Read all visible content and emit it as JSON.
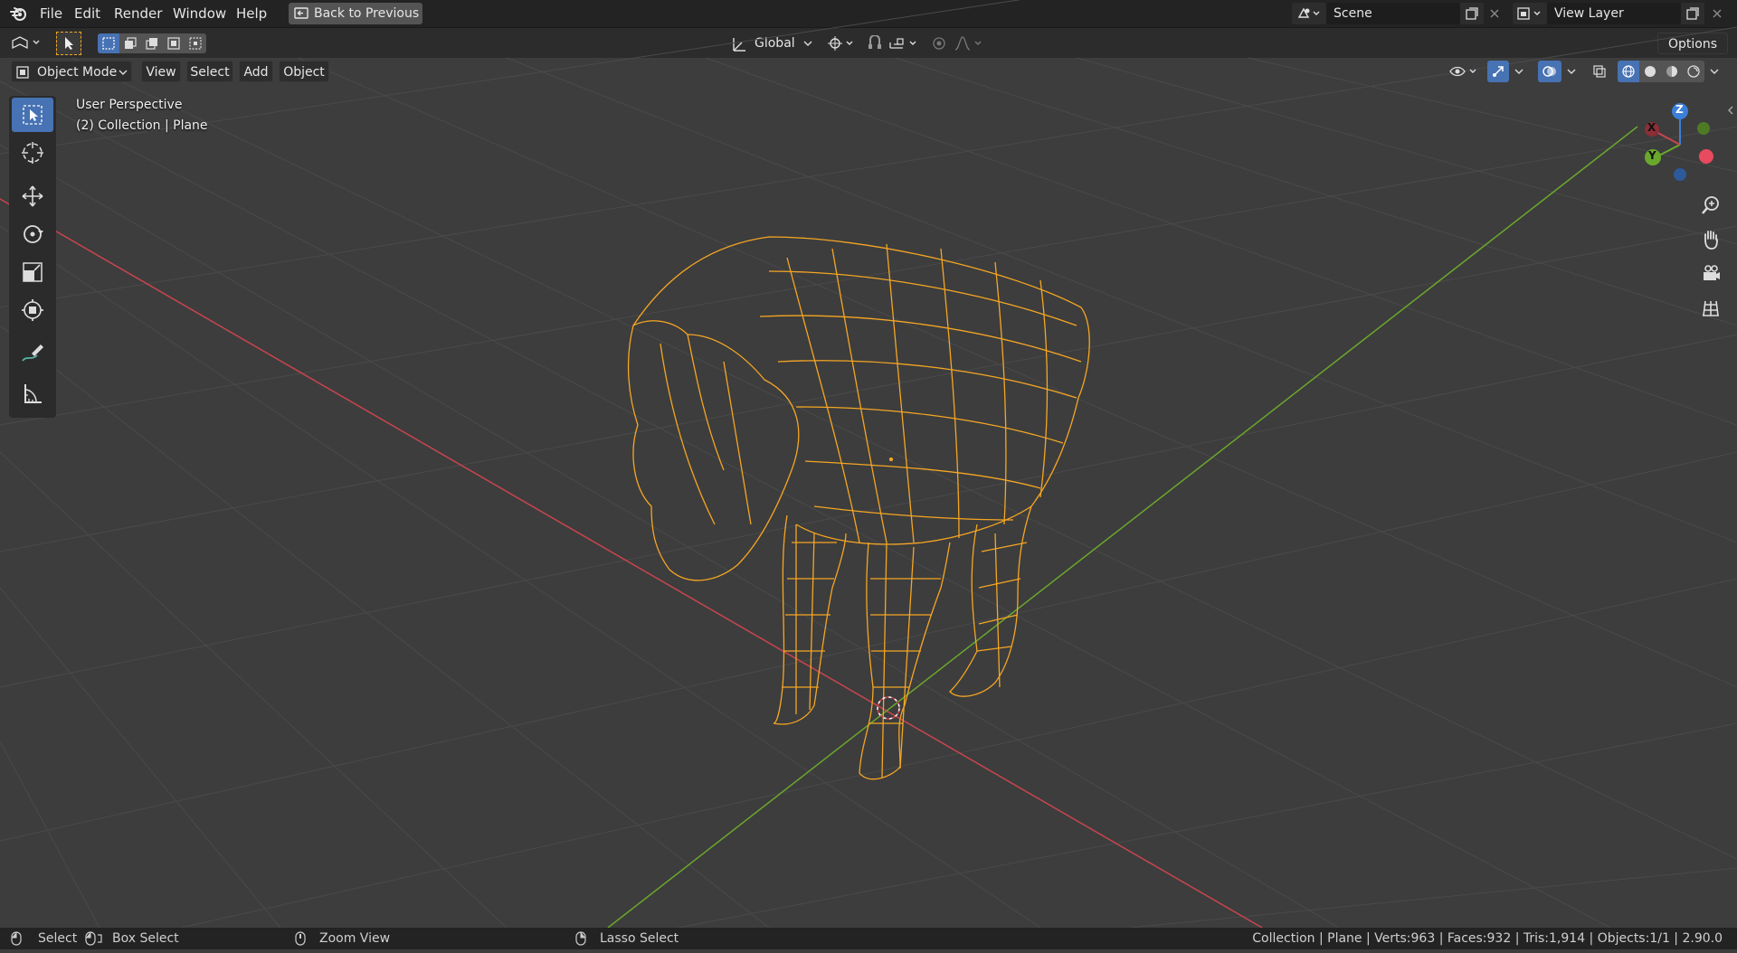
{
  "menu": {
    "items": [
      "File",
      "Edit",
      "Render",
      "Window",
      "Help"
    ],
    "back_to_previous": "Back to Previous"
  },
  "scene": {
    "label": "Scene"
  },
  "view_layer": {
    "label": "View Layer"
  },
  "header": {
    "orientation": "Global",
    "options": "Options"
  },
  "viewport_header": {
    "mode": "Object Mode",
    "menus": [
      "View",
      "Select",
      "Add",
      "Object"
    ]
  },
  "overlay": {
    "perspective": "User Perspective",
    "collection": "(2) Collection | Plane"
  },
  "gizmo": {
    "x": "X",
    "y": "Y",
    "z": "Z"
  },
  "status": {
    "select": "Select",
    "box_select": "Box Select",
    "zoom_view": "Zoom View",
    "lasso_select": "Lasso Select",
    "stats": "Collection | Plane | Verts:963 | Faces:932 | Tris:1,914 | Objects:1/1 | 2.90.0"
  },
  "colors": {
    "wire": "#f5a623",
    "x_axis": "#c8454f",
    "y_axis": "#6aa82c",
    "active_tool": "#4772b3"
  },
  "icons": {
    "blender_logo": "blender-icon",
    "select_tool": "cursor-arrow-icon",
    "cursor_tool": "crosshair-icon",
    "move_tool": "move-icon",
    "rotate_tool": "rotate-icon",
    "scale_tool": "scale-icon",
    "transform_tool": "transform-icon",
    "annotate_tool": "pencil-icon",
    "measure_tool": "ruler-icon"
  }
}
